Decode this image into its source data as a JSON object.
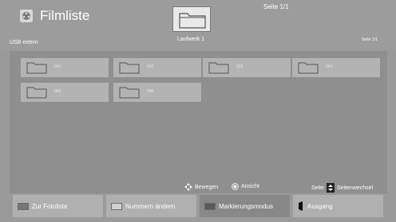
{
  "header": {
    "title": "Filmliste",
    "page_top": "Seite 1/1",
    "drive_label": "Laufwerk 1",
    "usb_label": "USB extern",
    "page_right": "Seite 1/1",
    "title_icon": "movie-reel-icon"
  },
  "folders": [
    {
      "name": "001"
    },
    {
      "name": "002"
    },
    {
      "name": "003"
    },
    {
      "name": "004"
    },
    {
      "name": "005"
    },
    {
      "name": "006"
    }
  ],
  "hints": {
    "move": "Bewegen",
    "view": "Ansicht",
    "page": "Seite",
    "page_change": "Seitenwechsel"
  },
  "buttons": [
    {
      "label": "Zur Fotoliste",
      "color": "#777777"
    },
    {
      "label": "Nummern ändern",
      "color": "#bdbdbd"
    },
    {
      "label": "Markierungsmodus",
      "color": "#5a5a5a"
    },
    {
      "label": "Ausgang",
      "color": "#222222"
    }
  ]
}
